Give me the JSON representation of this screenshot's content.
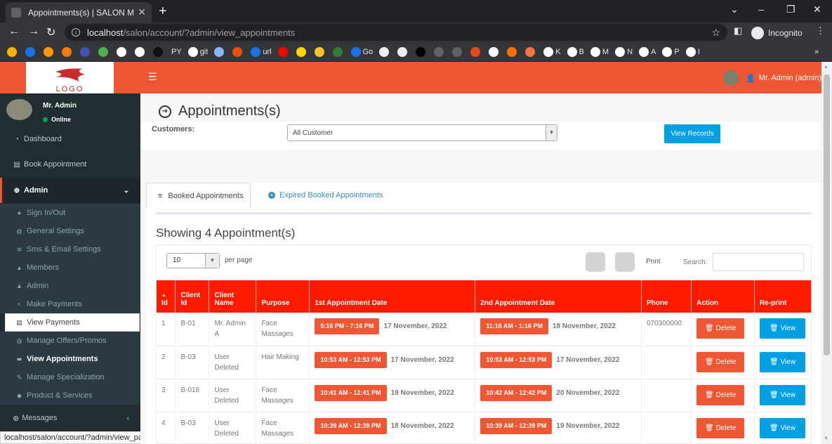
{
  "browser": {
    "tab_title": "Appointments(s) | SALON MANA",
    "new_tab": "+",
    "close": "✕",
    "url_host": "localhost",
    "url_path": "/salon/account/?admin/view_appointments",
    "incognito": "Incognito",
    "bookmarks": [
      "PY",
      "git",
      "url",
      "Go",
      "K",
      "B",
      "M",
      "N",
      "A",
      "P",
      "I"
    ]
  },
  "header": {
    "logo_text": "LOGO",
    "user": "Mr. Admin (admin)"
  },
  "sidebar": {
    "user_name": "Mr. Admin",
    "status": "Online",
    "top_items": [
      {
        "label": "Dashboard",
        "icon": "dashboard-icon"
      },
      {
        "label": "Book Appointment",
        "icon": "book-icon"
      }
    ],
    "admin_label": "Admin",
    "sub_items": [
      {
        "label": "Sign In/Out",
        "icon": "circle-icon"
      },
      {
        "label": "General Settings",
        "icon": "globe-icon"
      },
      {
        "label": "Sms & Email Settings",
        "icon": "wifi-icon"
      },
      {
        "label": "Members",
        "icon": "users-icon"
      },
      {
        "label": "Admin",
        "icon": "user-icon"
      },
      {
        "label": "Make Payments",
        "icon": "share-icon"
      },
      {
        "label": "View Payments",
        "icon": "book-icon"
      },
      {
        "label": "Manage Offers/Promos",
        "icon": "globe-icon"
      },
      {
        "label": "View Appointments",
        "icon": "link-icon"
      },
      {
        "label": "Manage Specialization",
        "icon": "pencil-icon"
      },
      {
        "label": "Product & Services",
        "icon": "tag-icon"
      }
    ],
    "messages_label": "Messages",
    "status_url": "localhost/salon/account/?admin/view_payments"
  },
  "page": {
    "title": "Appointments(s)",
    "customers_label": "Customers:",
    "customer_select": "All Customer",
    "view_records": "View Records",
    "tab_booked": "Booked Appointments",
    "tab_expired": "Expired Booked Appointments",
    "showing": "Showing 4 Appointment(s)",
    "per_page_value": "10",
    "per_page_label": "per page",
    "print_label": "Print",
    "search_label": "Search:"
  },
  "table": {
    "headers": [
      "Id",
      "Client Id",
      "Client Name",
      "Purpose",
      "1st Appointment Date",
      "2nd Appointment Date",
      "Phone",
      "Action",
      "Re-print"
    ],
    "delete_label": "Delete",
    "view_label": "View",
    "rows": [
      {
        "id": "1",
        "client_id": "B-01",
        "client_name": "Mr. Admin A",
        "purpose": "Face Massages",
        "t1": "5:16 PM - 7:16 PM",
        "d1": "17 November, 2022",
        "t2": "11:16 AM - 1:16 PM",
        "d2": "18 November, 2022",
        "phone": "070300000"
      },
      {
        "id": "2",
        "client_id": "B-03",
        "client_name": "User Deleted",
        "purpose": "Hair Making",
        "t1": "10:53 AM - 12:53 PM",
        "d1": "17 November, 2022",
        "t2": "10:53 AM - 12:53 PM",
        "d2": "17 November, 2022",
        "phone": ""
      },
      {
        "id": "3",
        "client_id": "B-018",
        "client_name": "User Deleted",
        "purpose": "Face Massages",
        "t1": "10:41 AM - 12:41 PM",
        "d1": "19 November, 2022",
        "t2": "10:42 AM - 12:42 PM",
        "d2": "20 November, 2022",
        "phone": ""
      },
      {
        "id": "4",
        "client_id": "B-03",
        "client_name": "User Deleted",
        "purpose": "Face Massages",
        "t1": "10:39 AM - 12:39 PM",
        "d1": "18 November, 2022",
        "t2": "10:39 AM - 12:39 PM",
        "d2": "19 November, 2022",
        "phone": ""
      }
    ]
  },
  "colors": {
    "brand": "#ee5634",
    "header_red": "#ff1a00",
    "info_blue": "#00a0e3",
    "sidebar_bg": "#222d32"
  }
}
